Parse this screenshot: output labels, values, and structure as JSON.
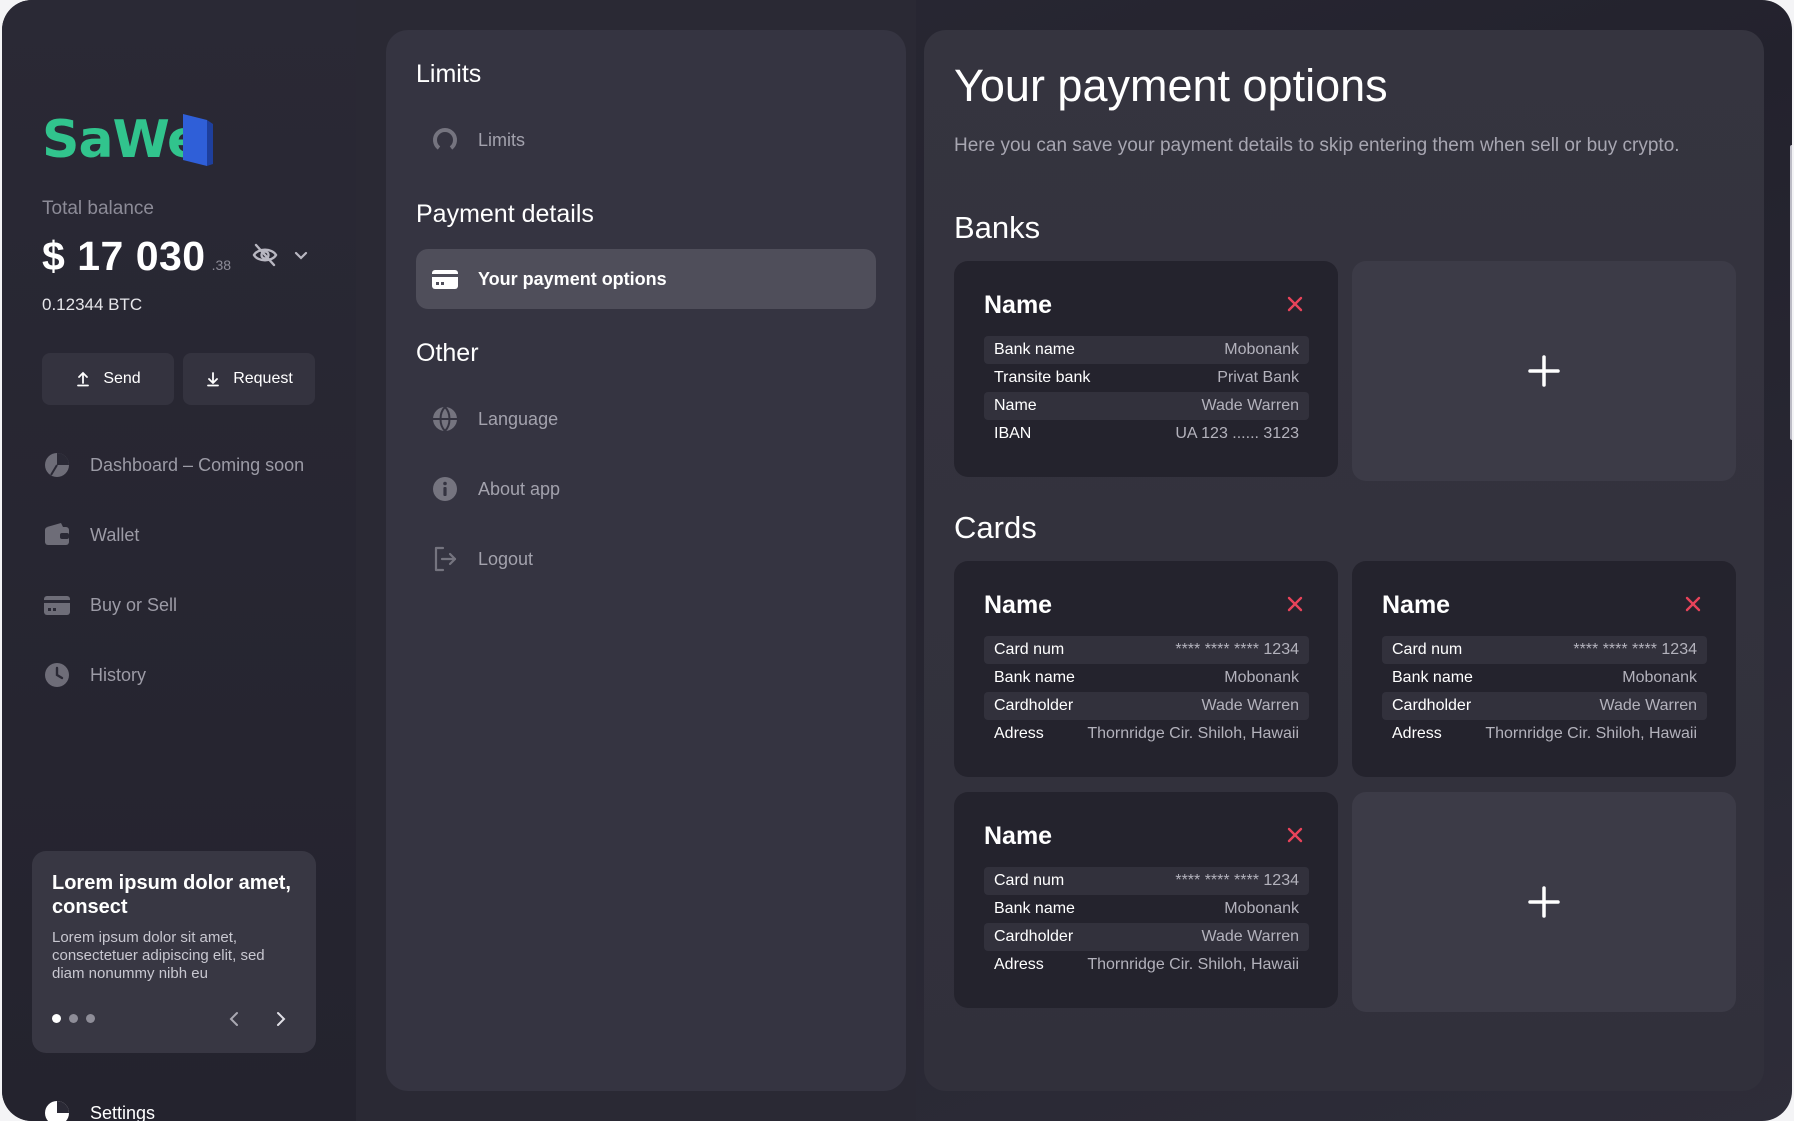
{
  "brand": {
    "logo_text": "SaWe",
    "accent": "#31c48d",
    "flag_color": "#2f5fd8"
  },
  "balance": {
    "label": "Total balance",
    "amount": "$ 17 030",
    "cents": ".38",
    "btc": "0.12344 BTC",
    "hide_icon": "eye-off-icon",
    "expand_icon": "chevron-down-icon"
  },
  "actions": {
    "send_label": "Send",
    "request_label": "Request"
  },
  "sidebar": {
    "items": [
      {
        "label": "Dashboard – Coming soon",
        "icon": "pie-chart-icon"
      },
      {
        "label": "Wallet",
        "icon": "wallet-icon"
      },
      {
        "label": "Buy or Sell",
        "icon": "credit-card-icon"
      },
      {
        "label": "History",
        "icon": "clock-icon"
      }
    ],
    "settings_label": "Settings"
  },
  "promo": {
    "title": "Lorem ipsum dolor amet, consect",
    "text": "Lorem ipsum dolor sit amet, consectetuer adipiscing elit, sed diam nonummy nibh eu",
    "active_dot": 1,
    "dot_count": 3
  },
  "menu": {
    "sections": [
      {
        "title": "Limits",
        "items": [
          {
            "label": "Limits",
            "icon": "limits-icon"
          }
        ]
      },
      {
        "title": "Payment details",
        "items": [
          {
            "label": "Your payment options",
            "icon": "card-icon",
            "active": true
          }
        ]
      },
      {
        "title": "Other",
        "items": [
          {
            "label": "Language",
            "icon": "globe-icon"
          },
          {
            "label": "About app",
            "icon": "info-icon"
          },
          {
            "label": "Logout",
            "icon": "logout-icon"
          }
        ]
      }
    ]
  },
  "main": {
    "title": "Your payment options",
    "subtitle": "Here you can save your payment details to skip entering them when sell or buy crypto.",
    "banks_title": "Banks",
    "cards_title": "Cards",
    "banks": [
      {
        "name": "Name",
        "rows": [
          {
            "k": "Bank name",
            "v": "Mobonank"
          },
          {
            "k": "Transite bank",
            "v": "Privat Bank"
          },
          {
            "k": "Name",
            "v": "Wade Warren"
          },
          {
            "k": "IBAN",
            "v": "UA 123 ...... 3123"
          }
        ]
      }
    ],
    "cards": [
      {
        "name": "Name",
        "rows": [
          {
            "k": "Card num",
            "v": "**** **** **** 1234"
          },
          {
            "k": "Bank name",
            "v": "Mobonank"
          },
          {
            "k": "Cardholder",
            "v": "Wade Warren"
          },
          {
            "k": "Adress",
            "v": "Thornridge Cir. Shiloh, Hawaii"
          }
        ]
      },
      {
        "name": "Name",
        "rows": [
          {
            "k": "Card num",
            "v": "**** **** **** 1234"
          },
          {
            "k": "Bank name",
            "v": "Mobonank"
          },
          {
            "k": "Cardholder",
            "v": "Wade Warren"
          },
          {
            "k": "Adress",
            "v": "Thornridge Cir. Shiloh, Hawaii"
          }
        ]
      },
      {
        "name": "Name",
        "rows": [
          {
            "k": "Card num",
            "v": "**** **** **** 1234"
          },
          {
            "k": "Bank name",
            "v": "Mobonank"
          },
          {
            "k": "Cardholder",
            "v": "Wade Warren"
          },
          {
            "k": "Adress",
            "v": "Thornridge Cir. Shiloh, Hawaii"
          }
        ]
      }
    ],
    "delete_color": "#e8435a",
    "add_icon": "plus-icon"
  }
}
